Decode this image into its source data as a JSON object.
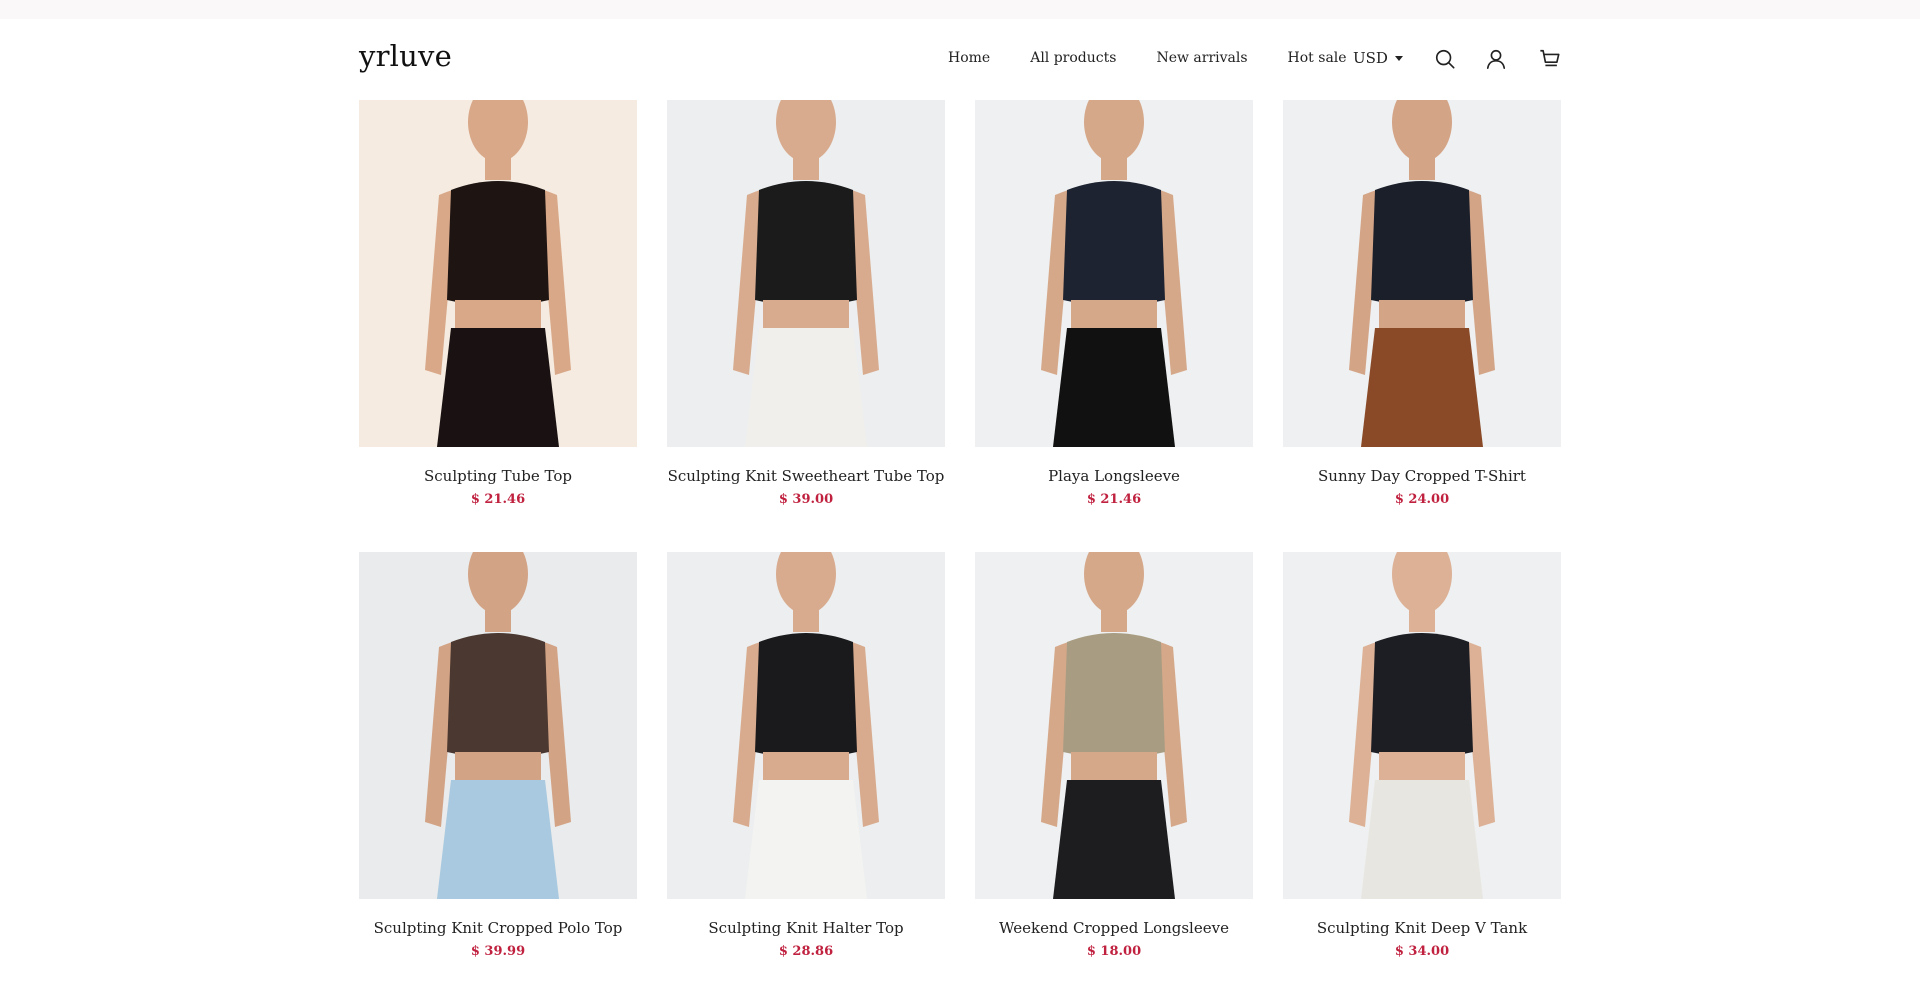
{
  "store": {
    "logo": "yrluve"
  },
  "nav": {
    "items": [
      {
        "label": "Home"
      },
      {
        "label": "All products"
      },
      {
        "label": "New arrivals"
      },
      {
        "label": "Hot sale"
      }
    ]
  },
  "header": {
    "currency": "USD",
    "icons": [
      "search-icon",
      "account-icon",
      "cart-icon"
    ]
  },
  "colors": {
    "price": "#c0213f",
    "topbar": "#faf8f8"
  },
  "products": [
    {
      "name": "Sculpting Tube Top",
      "price": "$ 21.46",
      "bg": "#f5ebe0",
      "top": "#1e1412",
      "bottom": "#1a1212",
      "skin": "#d9a889"
    },
    {
      "name": "Sculpting Knit Sweetheart Tube Top",
      "price": "$ 39.00",
      "bg": "#eceeef",
      "top": "#1b1b1c",
      "bottom": "#f0efec",
      "skin": "#d8ab8e"
    },
    {
      "name": "Playa Longsleeve",
      "price": "$ 21.46",
      "bg": "#eef0f1",
      "top": "#1d2330",
      "bottom": "#111111",
      "skin": "#d6a88a"
    },
    {
      "name": "Sunny Day Cropped T-Shirt",
      "price": "$ 24.00",
      "bg": "#eef0f1",
      "top": "#1b1f2a",
      "bottom": "#8a4a28",
      "skin": "#d4a487"
    },
    {
      "name": "Sculpting Knit Cropped Polo Top",
      "price": "$ 39.99",
      "bg": "#e9ebec",
      "top": "#4b3830",
      "bottom": "#a9c9e0",
      "skin": "#d3a386"
    },
    {
      "name": "Sculpting Knit Halter Top",
      "price": "$ 28.86",
      "bg": "#eceeef",
      "top": "#1a1a1c",
      "bottom": "#f3f3f1",
      "skin": "#d8ab8e"
    },
    {
      "name": "Weekend Cropped Longsleeve",
      "price": "$ 18.00",
      "bg": "#eef0f1",
      "top": "#a89d82",
      "bottom": "#1d1d1f",
      "skin": "#d6a88a"
    },
    {
      "name": "Sculpting Knit Deep V Tank",
      "price": "$ 34.00",
      "bg": "#eef0f1",
      "top": "#1d1e24",
      "bottom": "#e8e6e1",
      "skin": "#dcb196"
    }
  ]
}
